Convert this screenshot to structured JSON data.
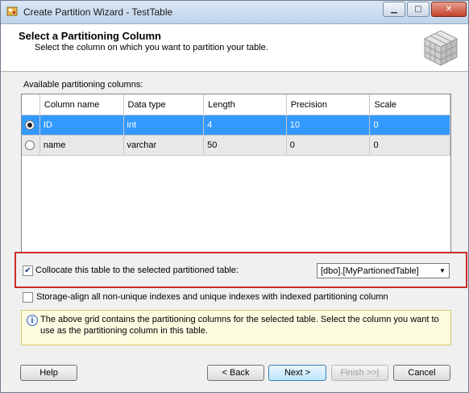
{
  "window": {
    "title": "Create Partition Wizard - TestTable"
  },
  "header": {
    "title": "Select a Partitioning Column",
    "subtitle": "Select the column on which you want to partition your table."
  },
  "grid": {
    "label": "Available partitioning columns:",
    "columns": [
      "Column name",
      "Data type",
      "Length",
      "Precision",
      "Scale"
    ],
    "rows": [
      {
        "selected": true,
        "cells": [
          "ID",
          "int",
          "4",
          "10",
          "0"
        ]
      },
      {
        "selected": false,
        "cells": [
          "name",
          "varchar",
          "50",
          "0",
          "0"
        ]
      }
    ]
  },
  "collocate": {
    "checked": true,
    "label": "Collocate this table to the selected partitioned table:",
    "selected_table": "[dbo].[MyPartionedTable]"
  },
  "storage_align": {
    "checked": false,
    "label": "Storage-align all non-unique indexes and unique indexes with indexed partitioning column"
  },
  "info": {
    "icon": "info-icon",
    "text": "The above grid contains the partitioning columns for the selected table. Select the column you want to use as the partitioning column in this table."
  },
  "buttons": {
    "help": "Help",
    "back": "< Back",
    "next": "Next >",
    "finish": "Finish >>|",
    "cancel": "Cancel"
  },
  "colors": {
    "selected_row": "#3399ff",
    "highlight_border": "#cc2b2b"
  }
}
